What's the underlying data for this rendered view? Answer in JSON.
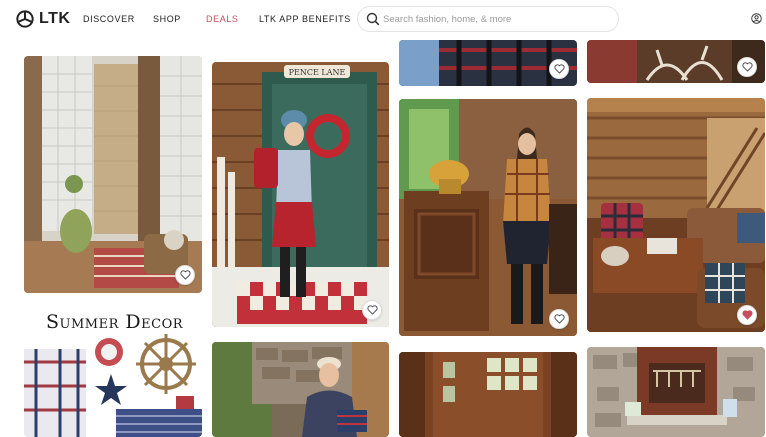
{
  "brand": {
    "name": "LTK"
  },
  "nav": {
    "discover": "DISCOVER",
    "shop": "SHOP",
    "deals": "DEALS",
    "app_benefits": "LTK APP BENEFITS"
  },
  "search": {
    "placeholder": "Search fashion, home, & more",
    "value": ""
  },
  "icons": {
    "logo": "ltk-logo-icon",
    "search": "search-icon",
    "user": "user-icon",
    "heart": "heart-icon"
  },
  "colors": {
    "deals": "#c8505e",
    "liked_heart": "#c8505e"
  },
  "tiles": [
    {
      "scene": "glass block shower bathroom",
      "liked": false
    },
    {
      "scene": "woman at green cabin door with wreath",
      "sign": "PENCE LANE",
      "liked": false
    },
    {
      "scene": "buffalo check flannel detail",
      "liked": false
    },
    {
      "scene": "antler chandelier cabin",
      "liked": false
    },
    {
      "scene": "woman in plaid shirt at wood bar",
      "liked": false
    },
    {
      "scene": "log cabin living room with plaid sofa",
      "liked": true
    },
    {
      "scene": "summer decor collage",
      "heading": "Summer Decor",
      "liked": false
    },
    {
      "scene": "woman with flag by stone wall",
      "liked": false
    },
    {
      "scene": "wooden door",
      "liked": false
    },
    {
      "scene": "stone fireplace",
      "liked": false
    }
  ]
}
